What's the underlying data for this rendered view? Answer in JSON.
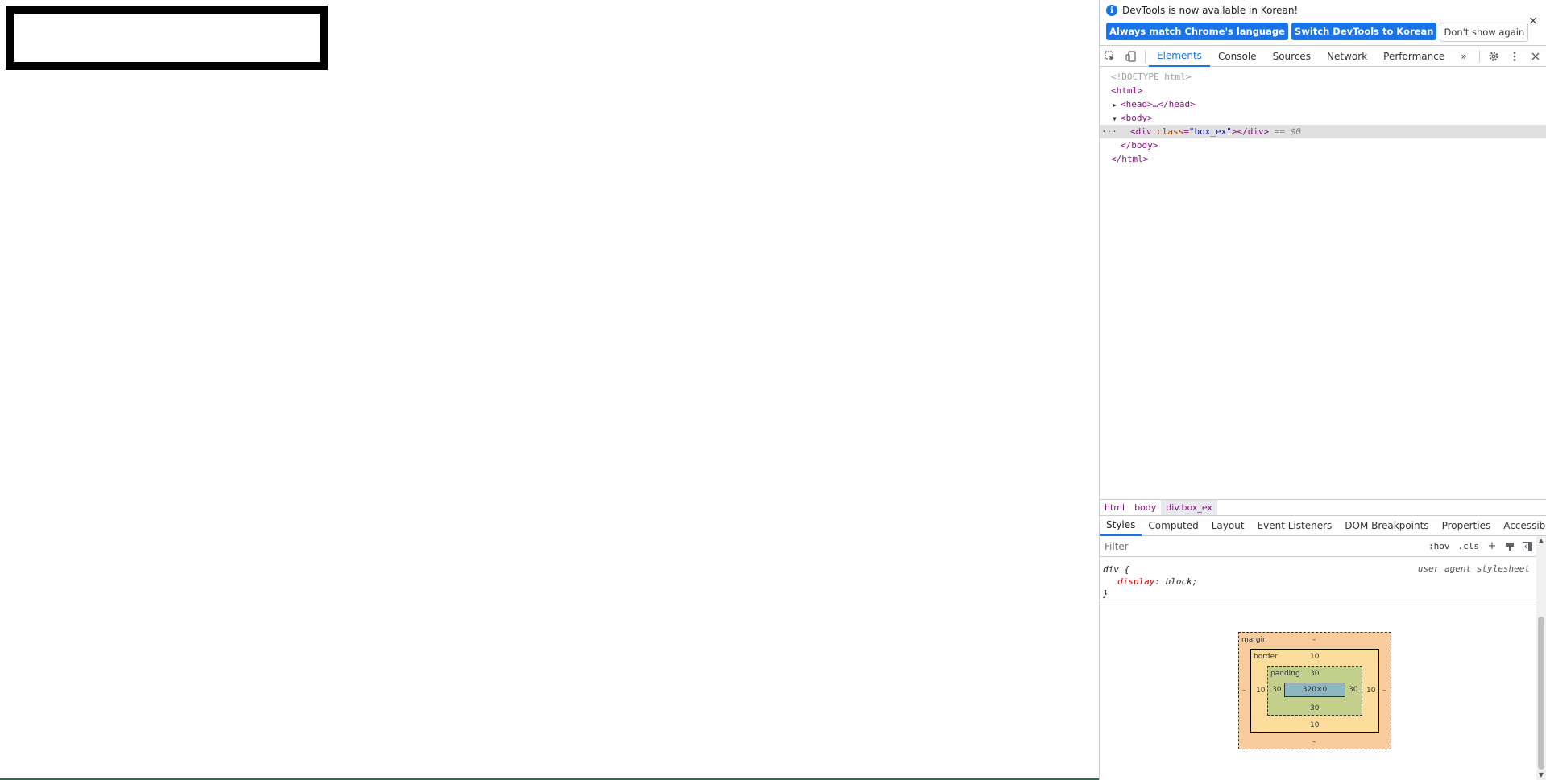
{
  "devtools": {
    "infobar": {
      "message": "DevTools is now available in Korean!",
      "always_match": "Always match Chrome's language",
      "switch_korean": "Switch DevTools to Korean",
      "dont_show": "Don't show again",
      "close": "×"
    },
    "tabs": [
      "Elements",
      "Console",
      "Sources",
      "Network",
      "Performance"
    ],
    "more_tabs": "»",
    "tree": {
      "doctype": "<!DOCTYPE html>",
      "html_open": "<html>",
      "head": "<head>…</head>",
      "body_open": "<body>",
      "div_open": "<div ",
      "div_attr_name": "class",
      "div_attr_val": "\"box_ex\"",
      "div_close": "></div>",
      "selected_marker": "== $0",
      "body_close": "</body>",
      "html_close": "</html>",
      "dots": "···"
    },
    "breadcrumbs": [
      "html",
      "body",
      "div.box_ex"
    ],
    "subtabs": [
      "Styles",
      "Computed",
      "Layout",
      "Event Listeners",
      "DOM Breakpoints",
      "Properties",
      "Accessibility"
    ],
    "filter": {
      "placeholder": "Filter",
      "hov": ":hov",
      "cls": ".cls",
      "add": "+"
    },
    "rule": {
      "selector": "div {",
      "prop": "display",
      "value": "block;",
      "close": "}",
      "source": "user agent stylesheet"
    },
    "box_model": {
      "margin_label": "margin",
      "margin_top": "–",
      "margin_bottom": "–",
      "margin_left": "–",
      "margin_right": "–",
      "border_label": "border",
      "border_top": "10",
      "border_bottom": "10",
      "border_left": "10",
      "border_right": "10",
      "padding_label": "padding",
      "padding_top": "30",
      "padding_bottom": "30",
      "padding_left": "30",
      "padding_right": "30",
      "content": "320×0"
    }
  }
}
